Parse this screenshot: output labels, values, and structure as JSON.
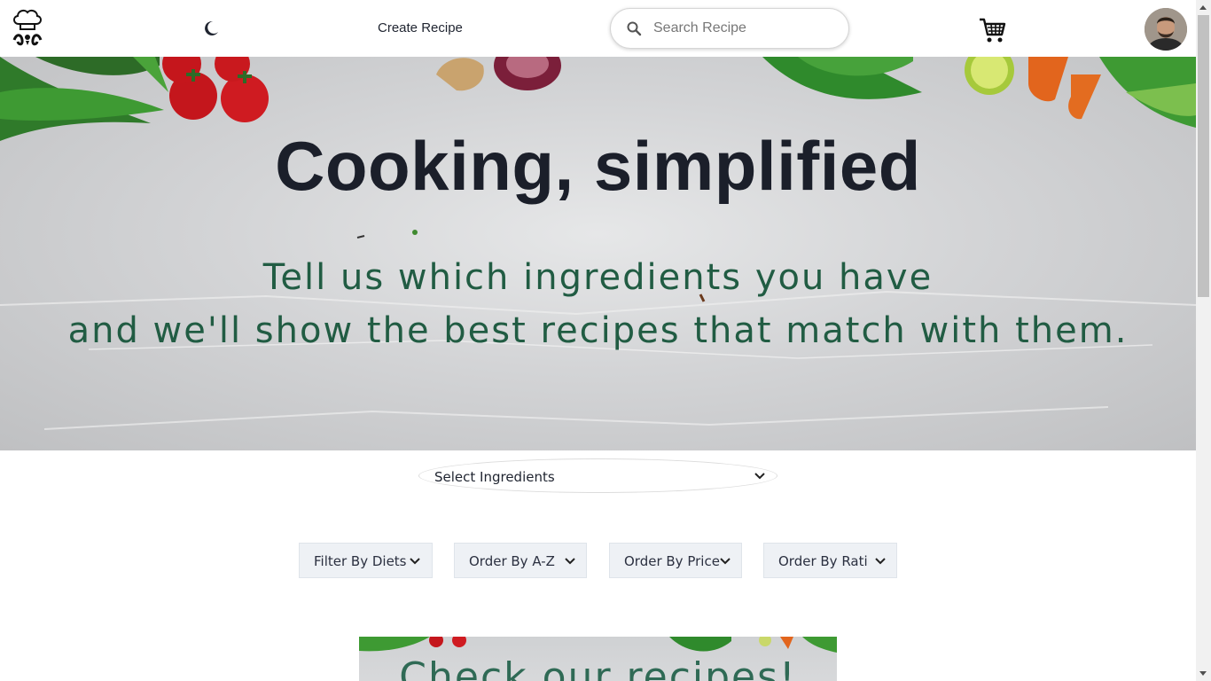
{
  "header": {
    "create_recipe_label": "Create Recipe",
    "search_placeholder": "Search Recipe"
  },
  "hero": {
    "title": "Cooking, simplified",
    "subtitle_line1": "Tell us which ingredients you have",
    "subtitle_line2": "and we'll show the best recipes that match with them."
  },
  "ingredients_select": {
    "label": "Select Ingredients"
  },
  "filters": [
    {
      "label": "Filter By Diets"
    },
    {
      "label": "Order By A-Z"
    },
    {
      "label": "Order By Price"
    },
    {
      "label": "Order By Rating"
    }
  ],
  "banner": {
    "title": "Check our recipes!"
  },
  "colors": {
    "title": "#1b1f2a",
    "subtitle_green": "#215c43",
    "filter_bg": "#eef1f5"
  },
  "icons": {
    "logo": "chef-hat-logo-icon",
    "theme": "moon-icon",
    "search": "search-icon",
    "cart": "shopping-cart-icon",
    "dropdown": "chevron-down-icon"
  }
}
